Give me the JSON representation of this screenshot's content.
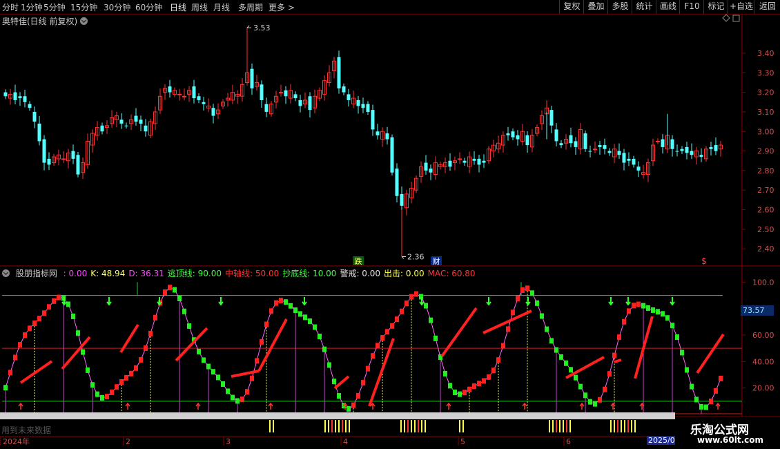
{
  "toolbar": {
    "timeframes": [
      {
        "label": "分时",
        "active": false
      },
      {
        "label": "1分钟",
        "active": false
      },
      {
        "label": "5分钟",
        "active": false
      },
      {
        "label": "15分钟",
        "active": false
      },
      {
        "label": "30分钟",
        "active": false
      },
      {
        "label": "60分钟",
        "active": false
      },
      {
        "label": "日线",
        "active": true
      },
      {
        "label": "周线",
        "active": false
      },
      {
        "label": "月线",
        "active": false
      },
      {
        "label": "多周期",
        "active": false
      },
      {
        "label": "更多 >",
        "active": false
      }
    ],
    "buttons": [
      "复权",
      "叠加",
      "多股",
      "统计",
      "画线",
      "F10",
      "标记",
      "+自选",
      "返回"
    ]
  },
  "price_panel": {
    "title": "奥特佳(日线 前复权)",
    "y_ticks": [
      "3.40",
      "3.30",
      "3.20",
      "3.10",
      "3.00",
      "2.90",
      "2.80",
      "2.70",
      "2.60",
      "2.50",
      "2.40"
    ],
    "high_label": "3.53",
    "low_label": "2.36",
    "markers": [
      "跌",
      "财",
      "$"
    ]
  },
  "indicator_panel": {
    "name": "股朋指标网",
    "params": [
      {
        "label": ": 0.00",
        "color": "#ff44ff"
      },
      {
        "label": "K: 48.94",
        "color": "#ffff66"
      },
      {
        "label": "D: 36.31",
        "color": "#ff44ff"
      },
      {
        "label": "逃顶线: 90.00",
        "color": "#44ff44"
      },
      {
        "label": "中轴线: 50.00",
        "color": "#ff3333"
      },
      {
        "label": "抄底线: 10.00",
        "color": "#44ff44"
      },
      {
        "label": "警戒: 0.00",
        "color": "#e0e0e0"
      },
      {
        "label": "出击: 0.00",
        "color": "#ffff44"
      },
      {
        "label": "MAC: 60.80",
        "color": "#ff3333"
      }
    ],
    "y_ticks": [
      "100.0",
      "60.00",
      "40.00",
      "20.00"
    ],
    "current_value": "73.57"
  },
  "time_axis": {
    "labels": [
      "2024年",
      "2",
      "3",
      "4",
      "5",
      "6"
    ],
    "year_badge": "2025/0"
  },
  "footer_caption": "用到未来数据",
  "watermark": {
    "line1": "乐淘公式网",
    "line2": "www.60lt.com"
  },
  "chart_data": {
    "type": "candlestick",
    "title": "奥特佳(日线 前复权)",
    "ylim": [
      2.33,
      3.58
    ],
    "annotations": {
      "high": 3.53,
      "low": 2.36
    },
    "ohlc_close_approx": [
      3.18,
      3.19,
      3.16,
      3.17,
      3.15,
      3.12,
      3.05,
      2.95,
      2.84,
      2.83,
      2.87,
      2.88,
      2.86,
      2.89,
      2.86,
      2.78,
      2.84,
      2.95,
      2.99,
      3.02,
      3.0,
      3.03,
      3.07,
      3.08,
      3.04,
      3.03,
      3.06,
      3.05,
      3.04,
      3.0,
      3.05,
      3.1,
      3.18,
      3.22,
      3.2,
      3.21,
      3.19,
      3.18,
      3.21,
      3.17,
      3.16,
      3.14,
      3.13,
      3.08,
      3.11,
      3.15,
      3.17,
      3.2,
      3.19,
      3.24,
      3.3,
      3.22,
      3.25,
      3.16,
      3.1,
      3.14,
      3.18,
      3.2,
      3.18,
      3.21,
      3.17,
      3.13,
      3.16,
      3.11,
      3.18,
      3.21,
      3.26,
      3.3,
      3.36,
      3.22,
      3.2,
      3.16,
      3.17,
      3.13,
      3.12,
      3.1,
      3.01,
      2.98,
      3.0,
      2.96,
      2.79,
      2.67,
      2.62,
      2.68,
      2.71,
      2.76,
      2.82,
      2.8,
      2.79,
      2.84,
      2.83,
      2.84,
      2.82,
      2.85,
      2.86,
      2.84,
      2.87,
      2.85,
      2.83,
      2.84,
      2.91,
      2.93,
      2.94,
      2.98,
      2.98,
      2.97,
      2.96,
      3.0,
      2.93,
      2.98,
      3.02,
      3.08,
      3.12,
      3.03,
      2.95,
      2.93,
      2.96,
      2.94,
      2.92,
      3.01,
      2.91,
      2.9,
      2.91,
      2.92,
      2.91,
      2.89,
      2.91,
      2.88,
      2.84,
      2.85,
      2.83,
      2.8,
      2.79,
      2.84,
      2.93,
      2.95,
      2.92,
      2.98,
      2.91,
      2.9,
      2.9,
      2.89,
      2.88,
      2.9,
      2.87,
      2.91,
      2.91,
      2.9,
      2.93
    ],
    "indicator": {
      "name": "股朋指标网",
      "K_current": 48.94,
      "D_current": 36.31,
      "top_line": 90,
      "mid_line": 50,
      "bottom_line": 10,
      "MAC": 60.8,
      "ylim": [
        0,
        108
      ]
    }
  }
}
